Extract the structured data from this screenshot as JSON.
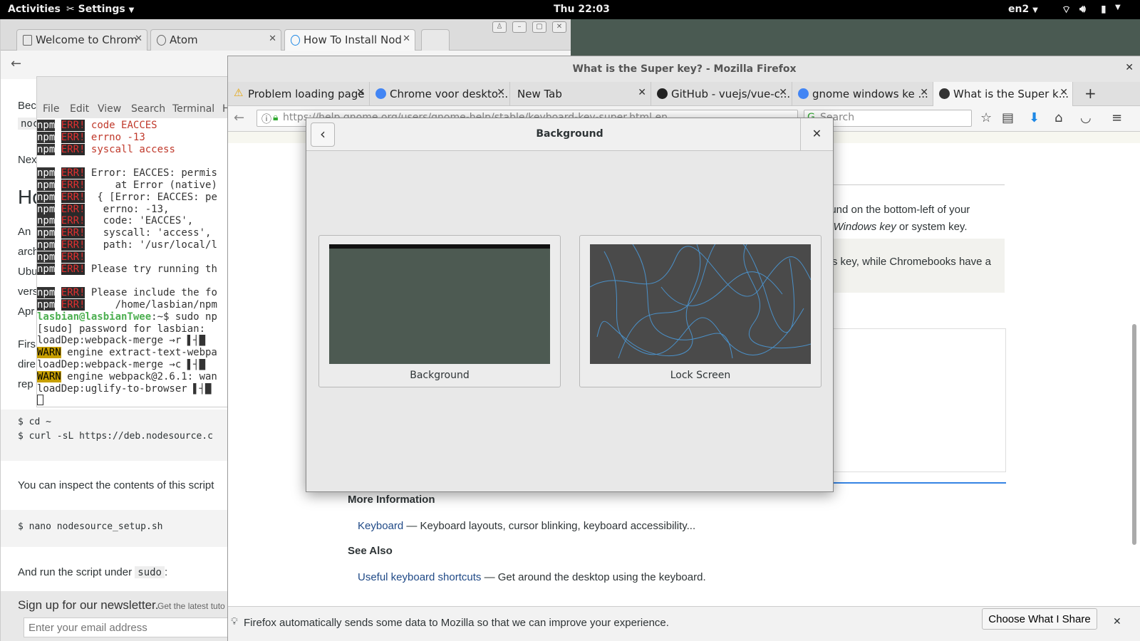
{
  "topbar": {
    "activities": "Activities",
    "app_menu": "Settings",
    "clock": "Thu 22:03",
    "lang": "en2"
  },
  "chrome": {
    "tabs": [
      {
        "label": "Welcome to Chrom"
      },
      {
        "label": "Atom"
      },
      {
        "label": "How To Install Nod"
      }
    ],
    "article": {
      "frag1": "Bec",
      "code1": "noc",
      "frag2": "Nex",
      "heading_frag": "Ho",
      "frag3": "An",
      "frag4": "arch",
      "frag5": "Ubu",
      "frag6": "vers",
      "frag7": "Apr",
      "frag8": "Firs",
      "frag9": "dire",
      "frag10": "rep",
      "code_block1": [
        "$ cd ~",
        "$ curl -sL https://deb.nodesource.c"
      ],
      "para_inspect": "You can inspect the contents of this script",
      "code_block2": "$ nano nodesource_setup.sh",
      "para_run": "And run the script under",
      "para_run_code": "sudo",
      "para_run_end": ":"
    },
    "newsletter": {
      "title": "Sign up for our newsletter.",
      "sub": "Get the latest tuto",
      "email_placeholder": "Enter your email address"
    }
  },
  "terminal": {
    "menu": [
      "File",
      "Edit",
      "View",
      "Search",
      "Terminal",
      "H"
    ],
    "lines": [
      {
        "tag": "err",
        "text": "code EACCES"
      },
      {
        "tag": "err",
        "text": "errno -13"
      },
      {
        "tag": "err",
        "text": "syscall access"
      },
      {
        "tag": "blank",
        "text": ""
      },
      {
        "tag": "err2",
        "text": "Error: EACCES: permis"
      },
      {
        "tag": "err2",
        "text": "    at Error (native)"
      },
      {
        "tag": "err2",
        "text": " { [Error: EACCES: pe"
      },
      {
        "tag": "err2",
        "text": "  errno: -13,"
      },
      {
        "tag": "err2",
        "text": "  code: 'EACCES',"
      },
      {
        "tag": "err2",
        "text": "  syscall: 'access',"
      },
      {
        "tag": "err2",
        "text": "  path: '/usr/local/l"
      },
      {
        "tag": "err2",
        "text": ""
      },
      {
        "tag": "err2",
        "text": "Please try running th"
      },
      {
        "tag": "blank",
        "text": ""
      },
      {
        "tag": "err2",
        "text": "Please include the fo"
      },
      {
        "tag": "err2",
        "text": "    /home/lasbian/npm"
      },
      {
        "tag": "prompt",
        "user": "lasbian@lasbianTwee",
        "text": ":~$ sudo np"
      },
      {
        "tag": "plain",
        "text": "[sudo] password for lasbian:"
      },
      {
        "tag": "plain",
        "text": "loadDep:webpack-merge →r ▌┤█"
      },
      {
        "tag": "warn",
        "text": " engine extract-text-webpa"
      },
      {
        "tag": "plain",
        "text": "loadDep:webpack-merge →c ▌┤█"
      },
      {
        "tag": "warn",
        "text": " engine webpack@2.6.1: wan"
      },
      {
        "tag": "plain",
        "text": "loadDep:uglify-to-browser ▌┤█"
      }
    ],
    "npm": "npm",
    "err": "ERR!",
    "warn": "WARN"
  },
  "firefox": {
    "title": "What is the Super key? - Mozilla Firefox",
    "tabs": [
      {
        "label": "Problem loading page",
        "icon": "warning-icon",
        "color": "#e5a50a"
      },
      {
        "label": "Chrome voor deskto...",
        "icon": "chrome-icon",
        "color": "#4285f4"
      },
      {
        "label": "New Tab",
        "icon": "none",
        "color": ""
      },
      {
        "label": "GitHub - vuejs/vue-c...",
        "icon": "github-icon",
        "color": "#222222"
      },
      {
        "label": "gnome windows ke ...",
        "icon": "google-icon",
        "color": "#4285f4"
      },
      {
        "label": "What is the Super k...",
        "icon": "gnome-icon",
        "color": "#333333"
      }
    ],
    "url": "https://help.gnome.org/users/gnome-help/stable/keyboard-key-super.html.en",
    "search_placeholder": "Search",
    "page": {
      "frag_a": "ound on the bottom-left of your",
      "frag_b_italic": "Windows key",
      "frag_b_pre": "e ",
      "frag_b_post": " or system key.",
      "frag_c": "ws key, while Chromebooks have a",
      "frag_dot": ".",
      "more_info": "More Information",
      "kb_link": "Keyboard",
      "kb_desc": " — Keyboard layouts, cursor blinking, keyboard accessibility...",
      "see_also": "See Also",
      "sc_link": "Useful keyboard shortcuts",
      "sc_desc": " — Get around the desktop using the keyboard."
    },
    "notification": {
      "text": "Firefox automatically sends some data to Mozilla so that we can improve your experience.",
      "button": "Choose What I Share"
    }
  },
  "dialog": {
    "title": "Background",
    "cards": [
      {
        "label": "Background"
      },
      {
        "label": "Lock Screen"
      }
    ]
  },
  "colors": {
    "topbar": "#000000",
    "accent_link": "#204a87",
    "bg_thumb": "#4d5a52",
    "lock_thumb": "#4a4a4a",
    "lock_lines": "#4a90c8"
  }
}
